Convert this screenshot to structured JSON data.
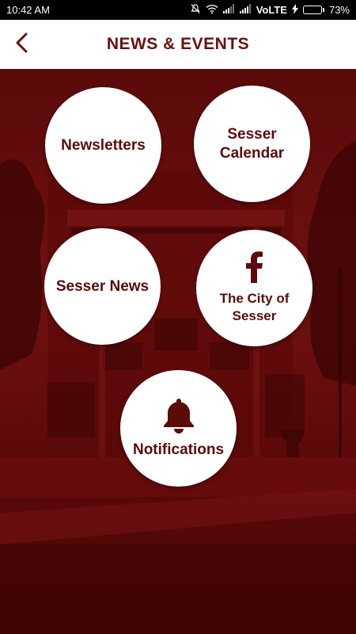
{
  "status_bar": {
    "time": "10:42 AM",
    "network": "VoLTE",
    "battery": "73%",
    "battery_level": 0.73
  },
  "header": {
    "title": "NEWS & EVENTS",
    "back_icon": "chevron-left-icon"
  },
  "tiles": [
    {
      "label": "Newsletters",
      "icon": ""
    },
    {
      "label": "Sesser Calendar",
      "icon": ""
    },
    {
      "label": "Sesser News",
      "icon": ""
    },
    {
      "label": "The City of Sesser",
      "icon": "facebook-icon"
    },
    {
      "label": "Notifications",
      "icon": "bell-icon"
    }
  ],
  "colors": {
    "brand": "#6b0f10",
    "background_tint": "#6e1111",
    "battery": "#4cd964"
  }
}
